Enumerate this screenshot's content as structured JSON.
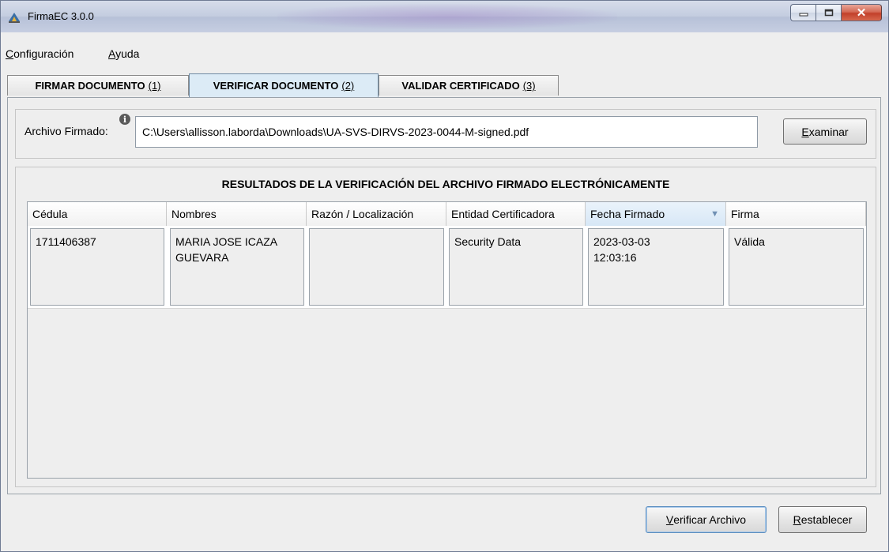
{
  "window": {
    "title": "FirmaEC 3.0.0"
  },
  "menu": [
    {
      "mnemonic": "C",
      "rest": "onfiguración"
    },
    {
      "mnemonic": "A",
      "rest": "yuda"
    }
  ],
  "tabs": [
    {
      "label": "FIRMAR DOCUMENTO",
      "shortcut": "(1)"
    },
    {
      "label": "VERIFICAR DOCUMENTO",
      "shortcut": "(2)"
    },
    {
      "label": "VALIDAR CERTIFICADO",
      "shortcut": "(3)"
    }
  ],
  "file": {
    "label": "Archivo Firmado:",
    "path": "C:\\Users\\allisson.laborda\\Downloads\\UA-SVS-DIRVS-2023-0044-M-signed.pdf",
    "browse_mnemonic": "E",
    "browse_rest": "xaminar"
  },
  "results": {
    "title": "RESULTADOS DE LA VERIFICACIÓN DEL ARCHIVO FIRMADO ELECTRÓNICAMENTE",
    "columns": [
      "Cédula",
      "Nombres",
      "Razón / Localización",
      "Entidad Certificadora",
      "Fecha Firmado",
      "Firma"
    ],
    "rows": [
      {
        "cedula": "1711406387",
        "nombres": "MARIA JOSE ICAZA\nGUEVARA",
        "razon": "",
        "entidad": "Security Data",
        "fecha": "2023-03-03\n12:03:16",
        "firma": "Válida"
      }
    ]
  },
  "buttons": {
    "verify_mnemonic": "V",
    "verify_rest": "erificar Archivo",
    "reset_mnemonic": "R",
    "reset_rest": "establecer"
  }
}
